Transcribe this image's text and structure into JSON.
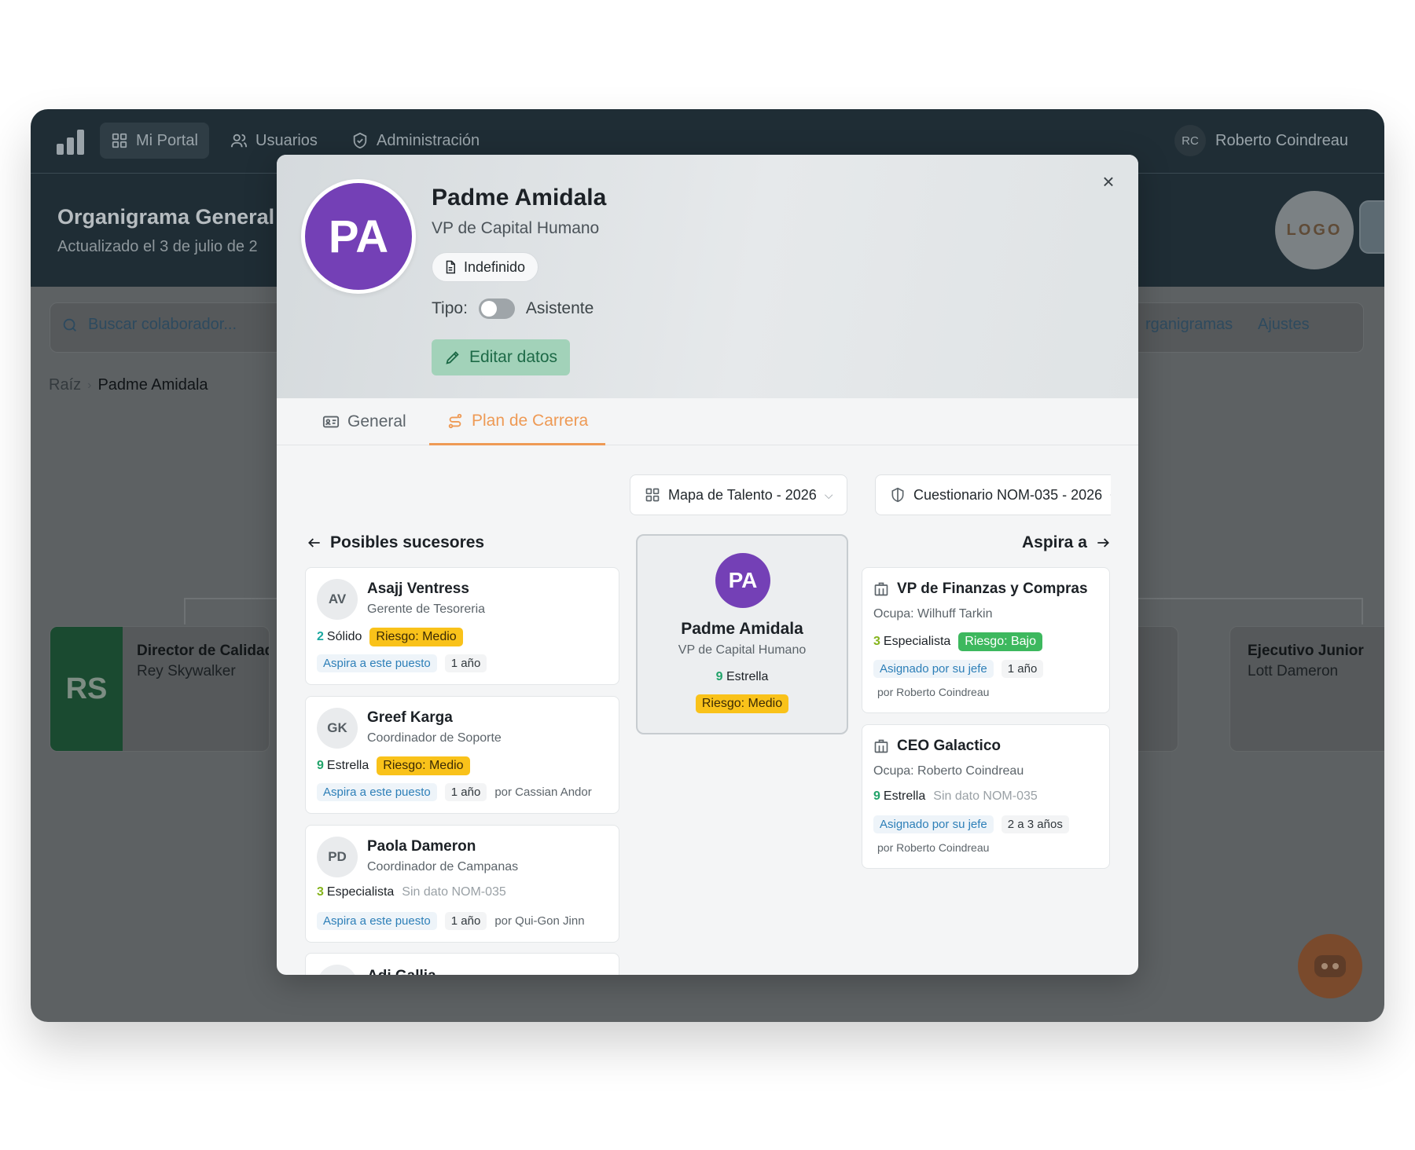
{
  "app": {
    "nav": {
      "mi_portal": "Mi Portal",
      "usuarios": "Usuarios",
      "administracion": "Administración"
    },
    "user": {
      "initials": "RC",
      "name": "Roberto Coindreau"
    },
    "header": {
      "title": "Organigrama General",
      "subtitle": "Actualizado el 3 de julio de 2",
      "logo": "LOGO"
    },
    "search": {
      "placeholder": "Buscar colaborador..."
    },
    "toolbar": {
      "organigramas": "rganigramas",
      "ajustes": "Ajustes"
    },
    "breadcrumb": {
      "root": "Raíz",
      "current": "Padme Amidala"
    },
    "org_cards": [
      {
        "initials": "RS",
        "role": "Director de Calidad",
        "name": "Rey Skywalker",
        "color": "#1a4a30"
      },
      {
        "role": "Ejecutivo Junior",
        "name": "Lott Dameron"
      }
    ]
  },
  "modal": {
    "initials": "PA",
    "name": "Padme Amidala",
    "role": "VP de Capital Humano",
    "contract": "Indefinido",
    "tipo_label": "Tipo:",
    "tipo_value": "Asistente",
    "tipo_on": false,
    "edit_label": "Editar datos",
    "close_icon": "close-icon",
    "tabs": [
      "General",
      "Plan de Carrera"
    ],
    "active_tab": "Plan de Carrera",
    "accent_color": "#ee9a55",
    "dropdowns": {
      "talent_map": "Mapa de Talento - 2026",
      "questionnaire": "Cuestionario NOM-035 - 2026"
    },
    "successors_title": "Posibles sucesores",
    "aspires_title": "Aspira a",
    "successors": [
      {
        "initials": "AV",
        "name": "Asajj Ventress",
        "role": "Gerente de Tesoreria",
        "level": "2",
        "level_label": "Sólido",
        "risk": "Riesgo: Medio",
        "tag": "Aspira a este puesto",
        "time": "1 año",
        "by": ""
      },
      {
        "initials": "GK",
        "name": "Greef Karga",
        "role": "Coordinador de Soporte",
        "level": "9",
        "level_label": "Estrella",
        "risk": "Riesgo: Medio",
        "tag": "Aspira a este puesto",
        "time": "1 año",
        "by": "por Cassian Andor"
      },
      {
        "initials": "PD",
        "name": "Paola Dameron",
        "role": "Coordinador de Campanas",
        "level": "3",
        "level_label": "Especialista",
        "risk": "Sin dato NOM-035",
        "tag": "Aspira a este puesto",
        "time": "1 año",
        "by": "por Qui-Gon Jinn"
      },
      {
        "initials": "",
        "name": "Adi Gallia"
      }
    ],
    "center": {
      "initials": "PA",
      "name": "Padme Amidala",
      "role": "VP de Capital Humano",
      "level": "9",
      "level_label": "Estrella",
      "risk": "Riesgo: Medio"
    },
    "aspires": [
      {
        "title": "VP de Finanzas y Compras",
        "occupant": "Ocupa: Wilhuff Tarkin",
        "level": "3",
        "level_label": "Especialista",
        "risk": "Riesgo: Bajo",
        "tag": "Asignado por su jefe",
        "time": "1 año",
        "by": "por Roberto Coindreau"
      },
      {
        "title": "CEO Galactico",
        "occupant": "Ocupa: Roberto Coindreau",
        "level": "9",
        "level_label": "Estrella",
        "risk": "Sin dato NOM-035",
        "tag": "Asignado por su jefe",
        "time": "2 a 3 años",
        "by": "por Roberto Coindreau"
      }
    ]
  }
}
